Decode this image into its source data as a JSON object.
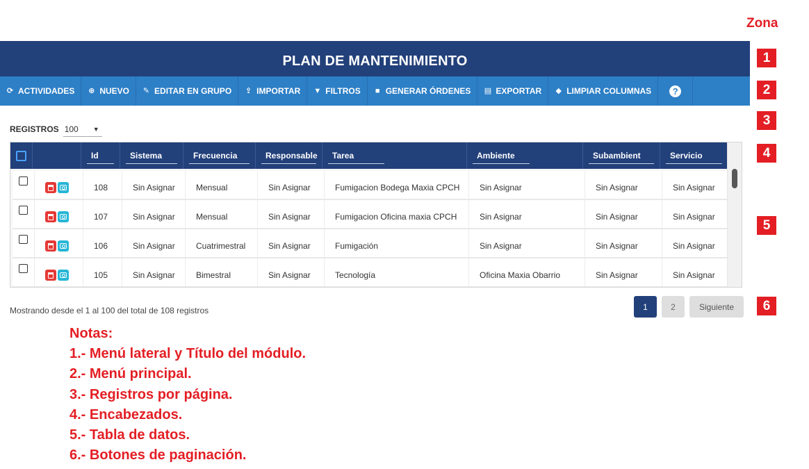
{
  "zona_title": "Zona",
  "module_title": "PLAN DE MANTENIMIENTO",
  "menu": [
    {
      "label": "ACTIVIDADES",
      "icon": "refresh-icon"
    },
    {
      "label": "NUEVO",
      "icon": "plus-circle-icon"
    },
    {
      "label": "EDITAR EN GRUPO",
      "icon": "edit-icon"
    },
    {
      "label": "IMPORTAR",
      "icon": "upload-icon"
    },
    {
      "label": "FILTROS",
      "icon": "filter-icon"
    },
    {
      "label": "GENERAR ÓRDENES",
      "icon": "note-icon"
    },
    {
      "label": "EXPORTAR",
      "icon": "excel-file-icon"
    },
    {
      "label": "LIMPIAR COLUMNAS",
      "icon": "eraser-icon"
    }
  ],
  "help_icon": "question-circle-icon",
  "zones": [
    "1",
    "2",
    "3",
    "4",
    "5",
    "6"
  ],
  "registros": {
    "label": "REGISTROS",
    "value": "100"
  },
  "table": {
    "headers": [
      "Id",
      "Sistema",
      "Frecuencia",
      "Responsable",
      "Tarea",
      "Ambiente",
      "Subambient",
      "Servicio"
    ],
    "rows": [
      [
        "108",
        "Sin Asignar",
        "Mensual",
        "Sin Asignar",
        "Fumigacion Bodega Maxia CPCH",
        "Sin Asignar",
        "Sin Asignar",
        "Sin Asignar"
      ],
      [
        "107",
        "Sin Asignar",
        "Mensual",
        "Sin Asignar",
        "Fumigacion Oficina maxia CPCH",
        "Sin Asignar",
        "Sin Asignar",
        "Sin Asignar"
      ],
      [
        "106",
        "Sin Asignar",
        "Cuatrimestral",
        "Sin Asignar",
        "Fumigación",
        "Sin Asignar",
        "Sin Asignar",
        "Sin Asignar"
      ],
      [
        "105",
        "Sin Asignar",
        "Bimestral",
        "Sin Asignar",
        "Tecnología",
        "Oficina Maxia Obarrio",
        "Sin Asignar",
        "Sin Asignar"
      ]
    ]
  },
  "showing_text": "Mostrando desde el 1 al 100 del total de 108 registros",
  "pagination": {
    "page1": "1",
    "page2": "2",
    "next": "Siguiente"
  },
  "notes": [
    "Notas:",
    "1.- Menú lateral y Título del módulo.",
    "2.- Menú principal.",
    "3.- Registros por página.",
    "4.- Encabezados.",
    "5.- Tabla de datos.",
    "6.- Botones de paginación."
  ],
  "colors": {
    "title_bar": "#22407a",
    "menu_bar": "#2d7fc6",
    "zone_red": "#e31e24"
  }
}
